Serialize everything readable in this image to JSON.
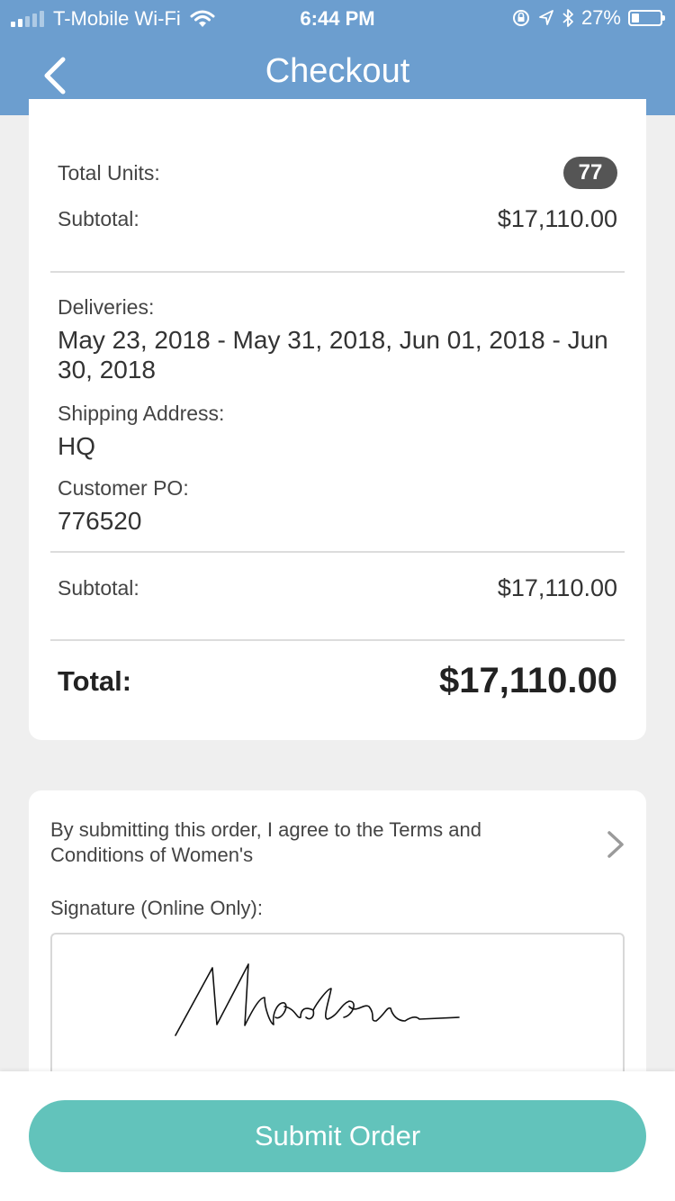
{
  "status_bar": {
    "carrier": "T-Mobile Wi-Fi",
    "time": "6:44 PM",
    "battery": "27%",
    "battery_level": 0.27,
    "icons": [
      "signal-icon",
      "wifi-icon",
      "orientation-lock-icon",
      "location-icon",
      "bluetooth-icon",
      "battery-icon"
    ]
  },
  "nav": {
    "title": "Checkout",
    "back_icon": "chevron-left-icon"
  },
  "summary": {
    "total_units_label": "Total Units:",
    "total_units_value": "77",
    "subtotal_label": "Subtotal:",
    "subtotal_value": "$17,110.00",
    "deliveries_label": "Deliveries:",
    "deliveries_value": "May 23, 2018 - May 31, 2018, Jun 01, 2018 - Jun 30, 2018",
    "shipping_label": "Shipping Address:",
    "shipping_value": "HQ",
    "po_label": "Customer PO:",
    "po_value": "776520",
    "subtotal2_label": "Subtotal:",
    "subtotal2_value": "$17,110.00",
    "total_label": "Total:",
    "total_value": "$17,110.00"
  },
  "terms": {
    "text": "By submitting this order, I agree to the Terms and Conditions of Women's",
    "chevron_icon": "chevron-right-icon",
    "signature_label": "Signature (Online Only):",
    "signature_text": "Morden"
  },
  "footer": {
    "submit_label": "Submit Order"
  },
  "colors": {
    "header": "#6c9ecf",
    "accent": "#62c3bb",
    "badge": "#555555",
    "background": "#efefef"
  }
}
